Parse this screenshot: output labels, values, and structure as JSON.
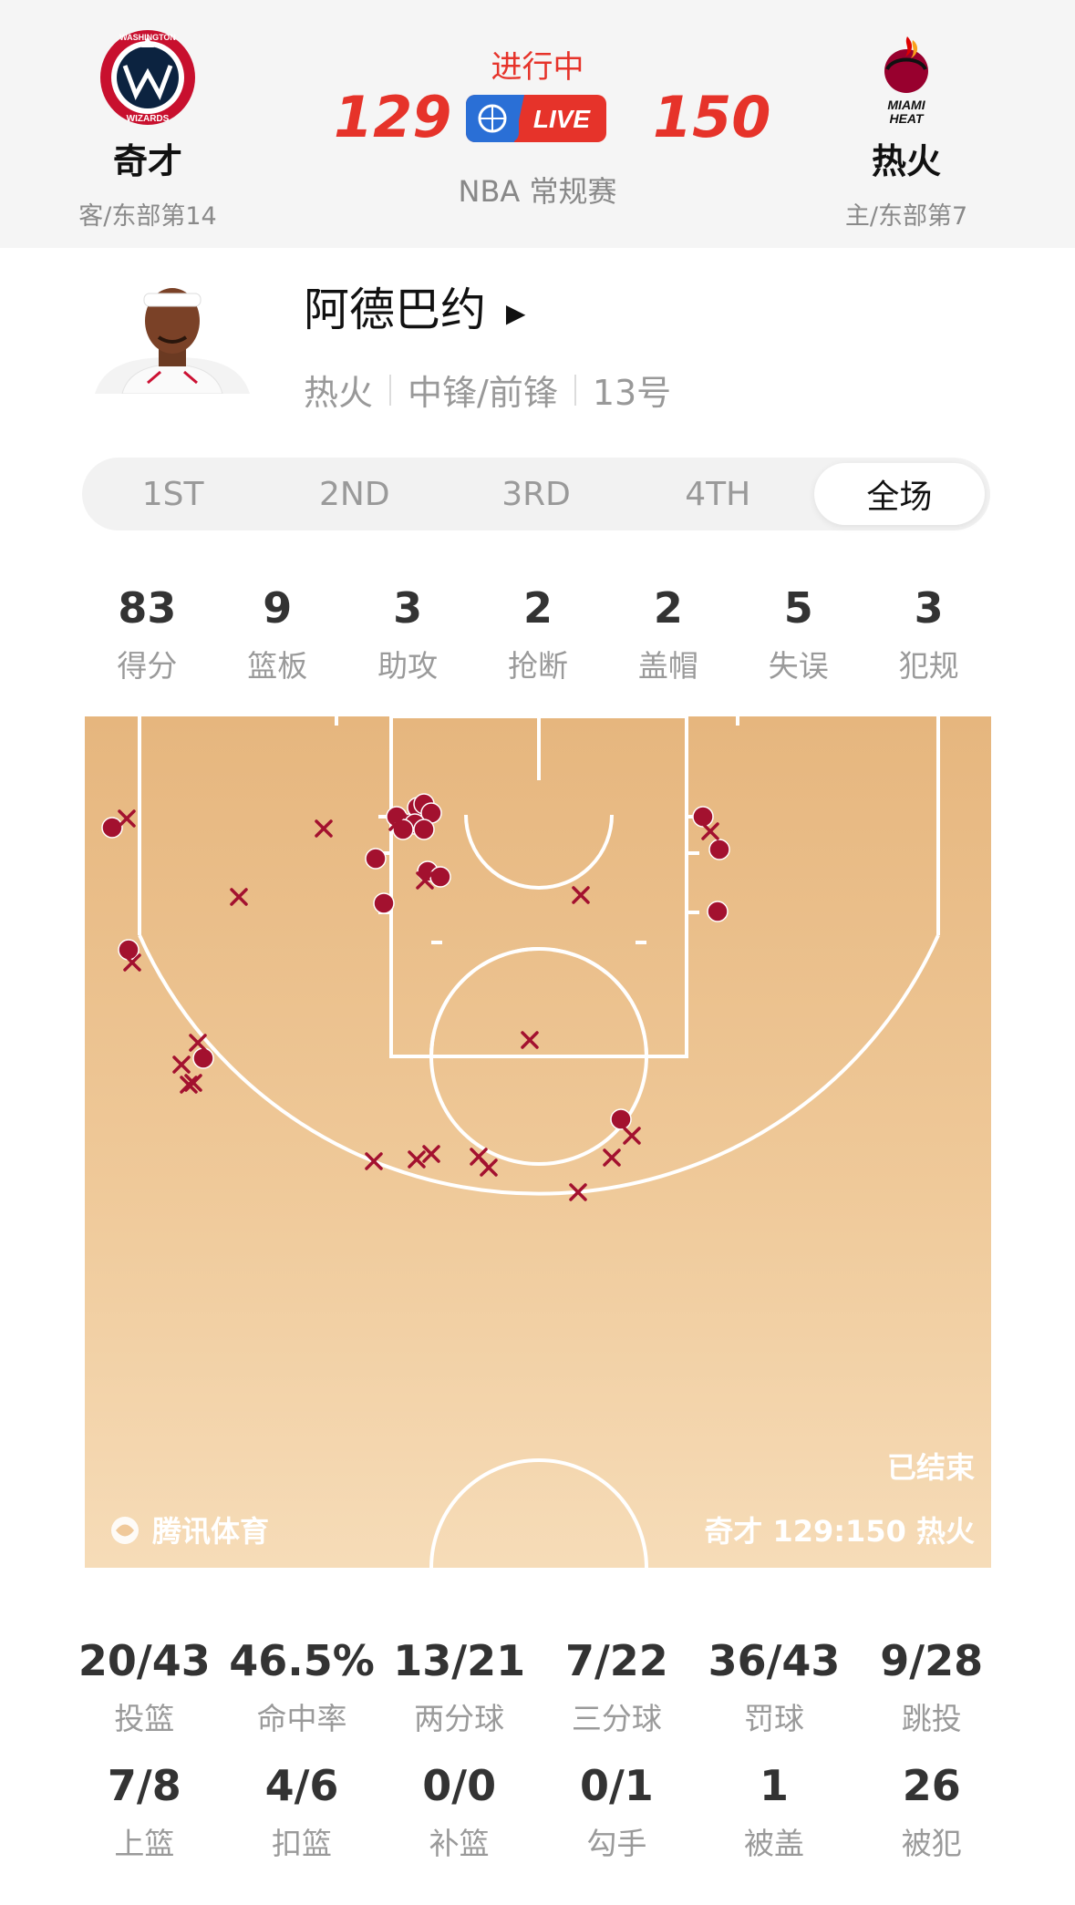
{
  "game": {
    "status": "进行中",
    "away_score": "129",
    "home_score": "150",
    "league": "NBA 常规赛",
    "live_label": "LIVE",
    "away": {
      "name": "奇才",
      "sub": "客/东部第14",
      "logo_text_top": "WASHINGTON",
      "logo_text_bottom": "WIZARDS",
      "color": "#c8102e"
    },
    "home": {
      "name": "热火",
      "sub": "主/东部第7",
      "logo_text_top": "MIAMI",
      "logo_text_bottom": "HEAT",
      "color": "#98002e"
    }
  },
  "player": {
    "name": "阿德巴约",
    "team": "热火",
    "position": "中锋/前锋",
    "number": "13号"
  },
  "tabs": [
    {
      "label": "1ST",
      "active": false
    },
    {
      "label": "2ND",
      "active": false
    },
    {
      "label": "3RD",
      "active": false
    },
    {
      "label": "4TH",
      "active": false
    },
    {
      "label": "全场",
      "active": true
    }
  ],
  "stats": [
    {
      "value": "83",
      "label": "得分"
    },
    {
      "value": "9",
      "label": "篮板"
    },
    {
      "value": "3",
      "label": "助攻"
    },
    {
      "value": "2",
      "label": "抢断"
    },
    {
      "value": "2",
      "label": "盖帽"
    },
    {
      "value": "5",
      "label": "失误"
    },
    {
      "value": "3",
      "label": "犯规"
    }
  ],
  "court": {
    "ended_label": "已结束",
    "brand": "腾讯体育",
    "final_score": "奇才 129:150 热火",
    "make_color": "#a3112f"
  },
  "shooting_row1": [
    {
      "value": "20/43",
      "label": "投篮"
    },
    {
      "value": "46.5%",
      "label": "命中率"
    },
    {
      "value": "13/21",
      "label": "两分球"
    },
    {
      "value": "7/22",
      "label": "三分球"
    },
    {
      "value": "36/43",
      "label": "罚球"
    },
    {
      "value": "9/28",
      "label": "跳投"
    }
  ],
  "shooting_row2": [
    {
      "value": "7/8",
      "label": "上篮"
    },
    {
      "value": "4/6",
      "label": "扣篮"
    },
    {
      "value": "0/0",
      "label": "补篮"
    },
    {
      "value": "0/1",
      "label": "勾手"
    },
    {
      "value": "1",
      "label": "被盖"
    },
    {
      "value": "26",
      "label": "被犯"
    }
  ]
}
